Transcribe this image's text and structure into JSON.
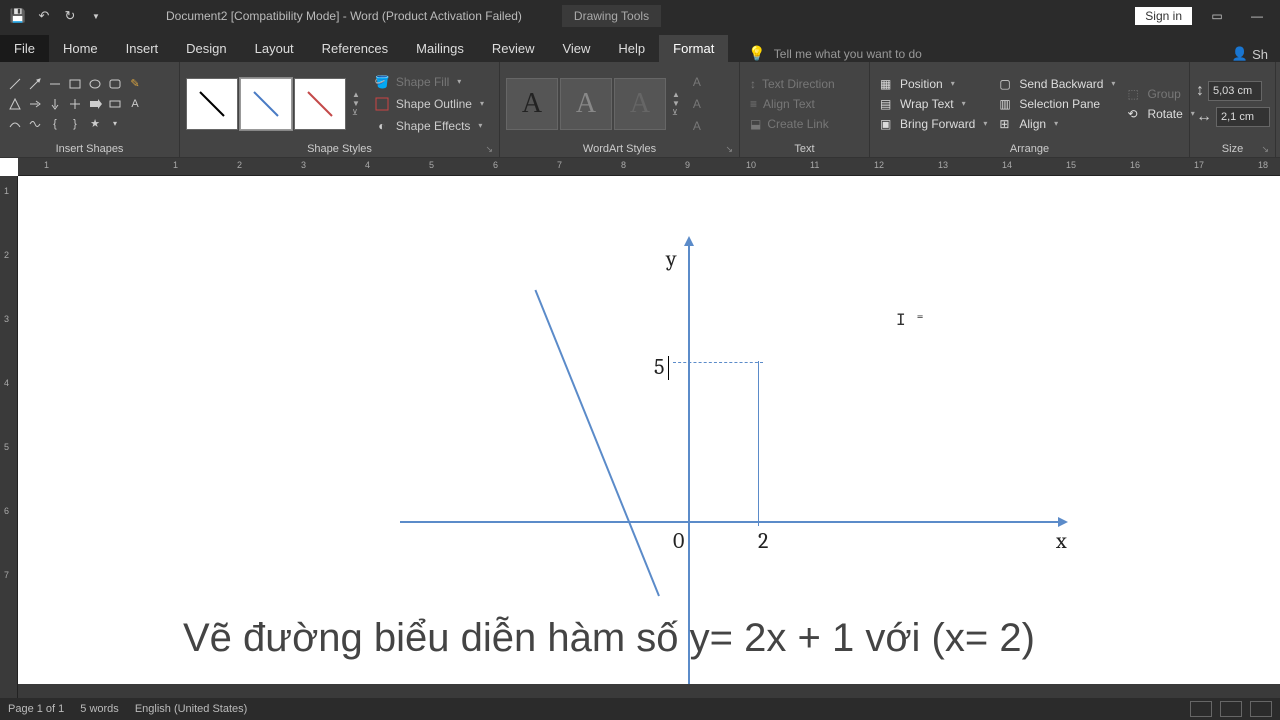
{
  "titlebar": {
    "doc_title": "Document2 [Compatibility Mode] - Word (Product Activation Failed)",
    "context_tab": "Drawing Tools",
    "signin": "Sign in"
  },
  "tabs": {
    "file": "File",
    "home": "Home",
    "insert": "Insert",
    "design": "Design",
    "layout": "Layout",
    "references": "References",
    "mailings": "Mailings",
    "review": "Review",
    "view": "View",
    "help": "Help",
    "format": "Format",
    "tellme": "Tell me what you want to do",
    "share": "Sh"
  },
  "ribbon": {
    "insert_shapes": "Insert Shapes",
    "shape_styles": "Shape Styles",
    "shape_fill": "Shape Fill",
    "shape_outline": "Shape Outline",
    "shape_effects": "Shape Effects",
    "wordart_styles": "WordArt Styles",
    "text": "Text",
    "text_direction": "Text Direction",
    "align_text": "Align Text",
    "create_link": "Create Link",
    "arrange": "Arrange",
    "position": "Position",
    "wrap_text": "Wrap Text",
    "bring_forward": "Bring Forward",
    "send_backward": "Send Backward",
    "selection_pane": "Selection Pane",
    "align": "Align",
    "group": "Group",
    "rotate": "Rotate",
    "size": "Size",
    "height": "5,03 cm",
    "width": "2,1 cm"
  },
  "graph": {
    "y_label": "y",
    "x_label": "x",
    "origin": "0",
    "x_tick": "2",
    "y_tick": "5"
  },
  "caption": "Vẽ đường biểu diễn hàm số y= 2x + 1 với (x= 2)",
  "status": {
    "page": "Page 1 of 1",
    "words": "5 words",
    "lang": "English (United States)"
  },
  "ruler_h": [
    "1",
    "1",
    "2",
    "3",
    "4",
    "5",
    "6",
    "7",
    "8",
    "9",
    "10",
    "11",
    "12",
    "13",
    "14",
    "15",
    "16",
    "17",
    "18"
  ],
  "ruler_v": [
    "1",
    "2",
    "3",
    "4",
    "5",
    "6",
    "7"
  ]
}
